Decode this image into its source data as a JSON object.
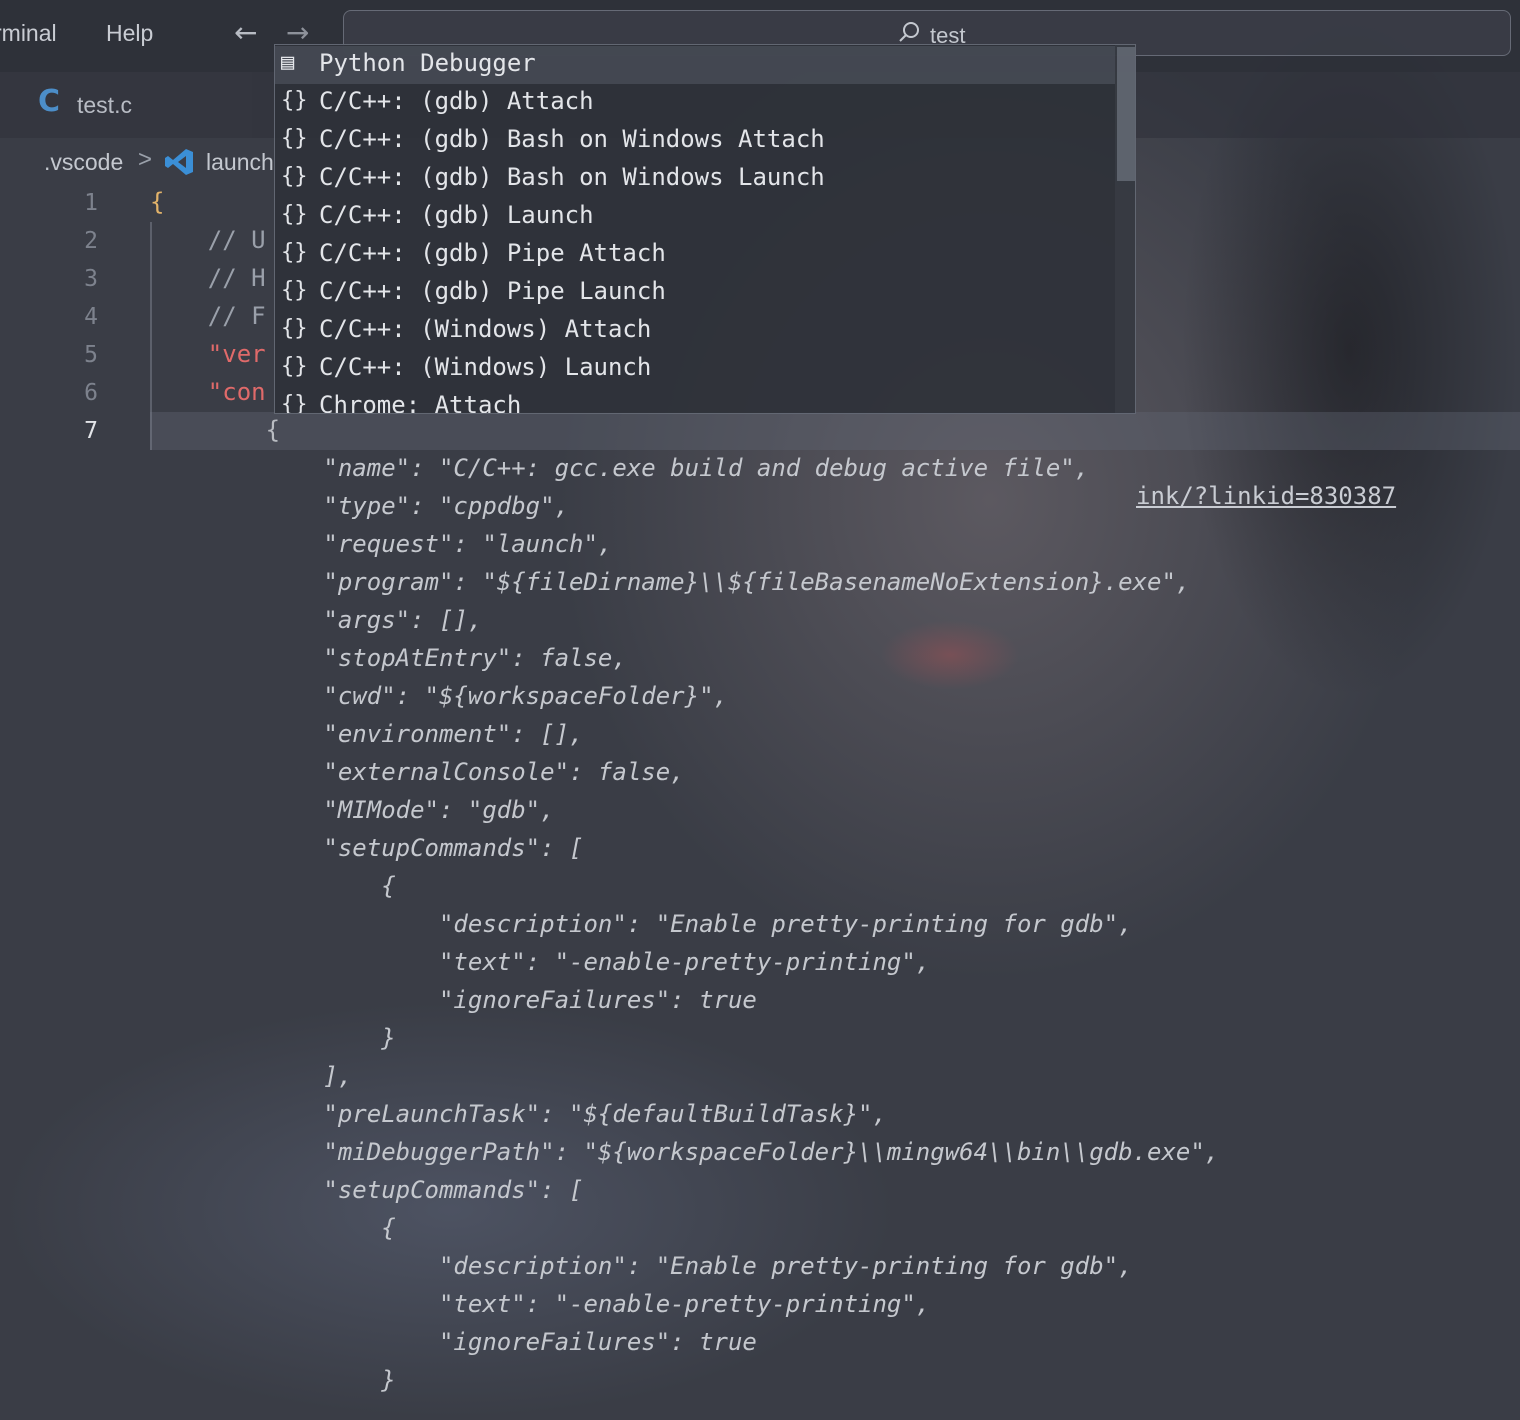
{
  "menu": {
    "terminal": "rminal",
    "help": "Help"
  },
  "nav": {
    "back": "←",
    "forward": "→"
  },
  "command_center": {
    "text": "test"
  },
  "tab": {
    "icon": "C",
    "label": "test.c"
  },
  "breadcrumb": {
    "folder": ".vscode",
    "separator": ">",
    "file": "launch"
  },
  "line_numbers": [
    "1",
    "2",
    "3",
    "4",
    "5",
    "6",
    "7"
  ],
  "code_lines": [
    {
      "text": "{",
      "cls": "tok-brace"
    },
    {
      "text": "    // U",
      "cls": "tok-comment"
    },
    {
      "text": "    // H",
      "cls": "tok-comment"
    },
    {
      "text": "    // F",
      "cls": "tok-comment"
    },
    {
      "text": "    \"ver",
      "cls": "tok-key"
    },
    {
      "text": "    \"con",
      "cls": "tok-key"
    },
    {
      "text": "        {",
      "cls": "tok-fade"
    },
    {
      "text": "            \"name\": \"C/C++: gcc.exe build and debug active file\",",
      "cls": "italic"
    },
    {
      "text": "            \"type\": \"cppdbg\",",
      "cls": "italic"
    },
    {
      "text": "            \"request\": \"launch\",",
      "cls": "italic"
    },
    {
      "text": "            \"program\": \"${fileDirname}\\\\${fileBasenameNoExtension}.exe\",",
      "cls": "italic"
    },
    {
      "text": "            \"args\": [],",
      "cls": "italic"
    },
    {
      "text": "            \"stopAtEntry\": false,",
      "cls": "italic"
    },
    {
      "text": "            \"cwd\": \"${workspaceFolder}\",",
      "cls": "italic"
    },
    {
      "text": "            \"environment\": [],",
      "cls": "italic"
    },
    {
      "text": "            \"externalConsole\": false,",
      "cls": "italic"
    },
    {
      "text": "            \"MIMode\": \"gdb\",",
      "cls": "italic"
    },
    {
      "text": "            \"setupCommands\": [",
      "cls": "italic"
    },
    {
      "text": "                {",
      "cls": "italic"
    },
    {
      "text": "                    \"description\": \"Enable pretty-printing for gdb\",",
      "cls": "italic"
    },
    {
      "text": "                    \"text\": \"-enable-pretty-printing\",",
      "cls": "italic"
    },
    {
      "text": "                    \"ignoreFailures\": true",
      "cls": "italic"
    },
    {
      "text": "                }",
      "cls": "italic"
    },
    {
      "text": "            ],",
      "cls": "italic"
    },
    {
      "text": "            \"preLaunchTask\": \"${defaultBuildTask}\",",
      "cls": "italic"
    },
    {
      "text": "            \"miDebuggerPath\": \"${workspaceFolder}\\\\mingw64\\\\bin\\\\gdb.exe\",",
      "cls": "italic"
    },
    {
      "text": "            \"setupCommands\": [",
      "cls": "italic"
    },
    {
      "text": "                {",
      "cls": "italic"
    },
    {
      "text": "                    \"description\": \"Enable pretty-printing for gdb\",",
      "cls": "italic"
    },
    {
      "text": "                    \"text\": \"-enable-pretty-printing\",",
      "cls": "italic"
    },
    {
      "text": "                    \"ignoreFailures\": true",
      "cls": "italic"
    },
    {
      "text": "                }",
      "cls": "italic"
    }
  ],
  "link_fragment": "ink/?linkid=830387",
  "suggestions": [
    {
      "icon": "snippet-icon",
      "glyph": "▤",
      "label": "Python Debugger",
      "selected": true
    },
    {
      "icon": "braces-icon",
      "glyph": "{}",
      "label": "C/C++: (gdb) Attach"
    },
    {
      "icon": "braces-icon",
      "glyph": "{}",
      "label": "C/C++: (gdb) Bash on Windows Attach"
    },
    {
      "icon": "braces-icon",
      "glyph": "{}",
      "label": "C/C++: (gdb) Bash on Windows Launch"
    },
    {
      "icon": "braces-icon",
      "glyph": "{}",
      "label": "C/C++: (gdb) Launch"
    },
    {
      "icon": "braces-icon",
      "glyph": "{}",
      "label": "C/C++: (gdb) Pipe Attach"
    },
    {
      "icon": "braces-icon",
      "glyph": "{}",
      "label": "C/C++: (gdb) Pipe Launch"
    },
    {
      "icon": "braces-icon",
      "glyph": "{}",
      "label": "C/C++: (Windows) Attach"
    },
    {
      "icon": "braces-icon",
      "glyph": "{}",
      "label": "C/C++: (Windows) Launch"
    },
    {
      "icon": "braces-icon",
      "glyph": "{}",
      "label": "Chrome: Attach"
    }
  ],
  "colors": {
    "accent_c": "#4c8ec9",
    "vscode_blue": "#3b8fd6",
    "key_red": "#e06a6a",
    "brace_gold": "#e2b36a"
  }
}
